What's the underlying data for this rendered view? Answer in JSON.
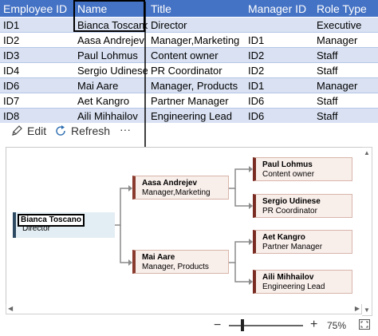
{
  "table": {
    "headers": [
      "Employee ID",
      "Name",
      "Title",
      "Manager ID",
      "Role Type"
    ],
    "rows": [
      [
        "ID1",
        "Bianca Toscano",
        "Director",
        "",
        "Executive"
      ],
      [
        "ID2",
        "Aasa Andrejev",
        "Manager,Marketing",
        "ID1",
        "Manager"
      ],
      [
        "ID3",
        "Paul Lohmus",
        "Content owner",
        "ID2",
        "Staff"
      ],
      [
        "ID4",
        "Sergio Udinese",
        "PR Coordinator",
        "ID2",
        "Staff"
      ],
      [
        "ID6",
        "Mai Aare",
        "Manager, Products",
        "ID1",
        "Manager"
      ],
      [
        "ID7",
        "Aet Kangro",
        "Partner Manager",
        "ID6",
        "Staff"
      ],
      [
        "ID8",
        "Aili Mihhailov",
        "Engineering Lead",
        "ID6",
        "Staff"
      ]
    ]
  },
  "toolbar": {
    "edit_label": "Edit",
    "refresh_label": "Refresh",
    "more_label": "···"
  },
  "chart": {
    "root": {
      "name": "Bianca Toscano",
      "title": "Director"
    },
    "mid": [
      {
        "name": "Aasa Andrejev",
        "title": "Manager,Marketing"
      },
      {
        "name": "Mai Aare",
        "title": "Manager, Products"
      }
    ],
    "leaves": [
      {
        "name": "Paul Lohmus",
        "title": "Content owner"
      },
      {
        "name": "Sergio Udinese",
        "title": "PR Coordinator"
      },
      {
        "name": "Aet Kangro",
        "title": "Partner Manager"
      },
      {
        "name": "Aili Mihhailov",
        "title": "Engineering Lead"
      }
    ]
  },
  "zoom": {
    "minus": "−",
    "plus": "+",
    "level": "75%"
  },
  "colors": {
    "header_bg": "#4472c4",
    "band_bg": "#d9e1f2",
    "root_accent": "#2e4a62",
    "node_accent": "#8b3a2e"
  }
}
